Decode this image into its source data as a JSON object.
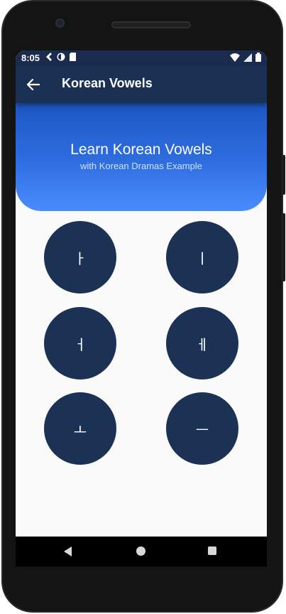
{
  "status_bar": {
    "time": "8:05"
  },
  "app_bar": {
    "title": "Korean Vowels"
  },
  "hero": {
    "title": "Learn Korean Vowels",
    "subtitle": "with Korean Dramas Example"
  },
  "vowels": [
    "ㅏ",
    "ㅣ",
    "ㅓ",
    "ㅔ",
    "ㅗ",
    "ㅡ"
  ],
  "colors": {
    "app_bar": "#1b3153",
    "vowel_button": "#1c3254",
    "hero_top": "#1d56c4",
    "hero_bottom": "#4a8cff",
    "background": "#fafafa"
  }
}
